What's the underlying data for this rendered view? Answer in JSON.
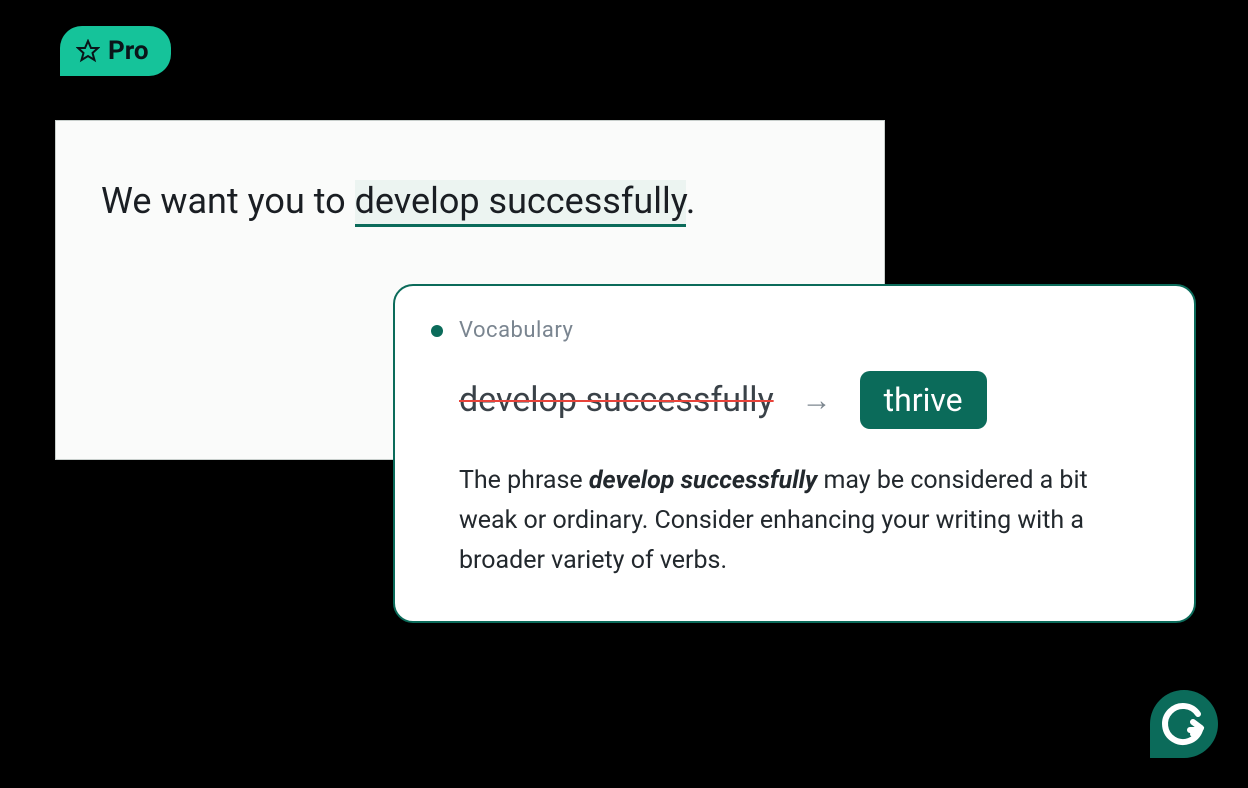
{
  "badge": {
    "label": "Pro"
  },
  "editor": {
    "text_before": "We want you to ",
    "highlighted": "develop successfully",
    "text_after": "."
  },
  "suggestion": {
    "category": "Vocabulary",
    "original_phrase": "develop successfully",
    "replacement": "thrive",
    "explanation_before": "The phrase ",
    "explanation_bold": "develop successfully",
    "explanation_after": " may be considered a bit weak or ordinary. Consider enhancing your writing with a broader variety of verbs."
  },
  "colors": {
    "badge_bg": "#15c39a",
    "accent": "#0b6b5a",
    "strike": "#e8433a"
  }
}
